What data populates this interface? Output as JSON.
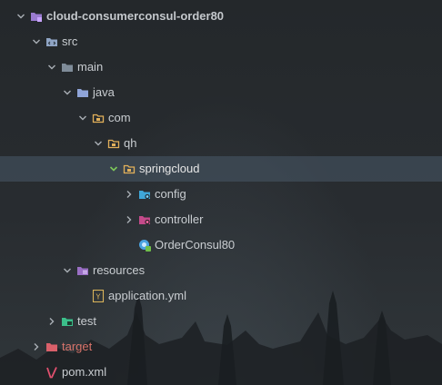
{
  "project_tree": {
    "root": {
      "label": "cloud-consumerconsul-order80",
      "icon": "module-folder-icon",
      "expanded": true
    },
    "src": {
      "label": "src",
      "icon": "source-folder-icon",
      "expanded": true
    },
    "main": {
      "label": "main",
      "icon": "folder-icon",
      "expanded": true
    },
    "java": {
      "label": "java",
      "icon": "java-source-root-icon",
      "expanded": true
    },
    "com": {
      "label": "com",
      "icon": "package-icon",
      "expanded": true
    },
    "qh": {
      "label": "qh",
      "icon": "package-icon",
      "expanded": true
    },
    "springcloud": {
      "label": "springcloud",
      "icon": "package-icon",
      "expanded": true,
      "selected": true
    },
    "config": {
      "label": "config",
      "icon": "config-package-icon",
      "expanded": false
    },
    "controller": {
      "label": "controller",
      "icon": "controller-package-icon",
      "expanded": false
    },
    "orderconsul": {
      "label": "OrderConsul80",
      "icon": "spring-boot-class-icon"
    },
    "resources": {
      "label": "resources",
      "icon": "resources-folder-icon",
      "expanded": true
    },
    "application_yml": {
      "label": "application.yml",
      "icon": "yaml-file-icon"
    },
    "test": {
      "label": "test",
      "icon": "test-folder-icon",
      "expanded": false
    },
    "target": {
      "label": "target",
      "icon": "excluded-folder-icon",
      "expanded": false
    },
    "pom": {
      "label": "pom.xml",
      "icon": "maven-icon"
    }
  },
  "colors": {
    "selection": "#3d4c57",
    "text": "#c9cdd1",
    "excluded_text": "#d9746b",
    "folder": "#8fa4c4",
    "package": "#e2b05a",
    "chevron_active": "#7ec85a"
  }
}
